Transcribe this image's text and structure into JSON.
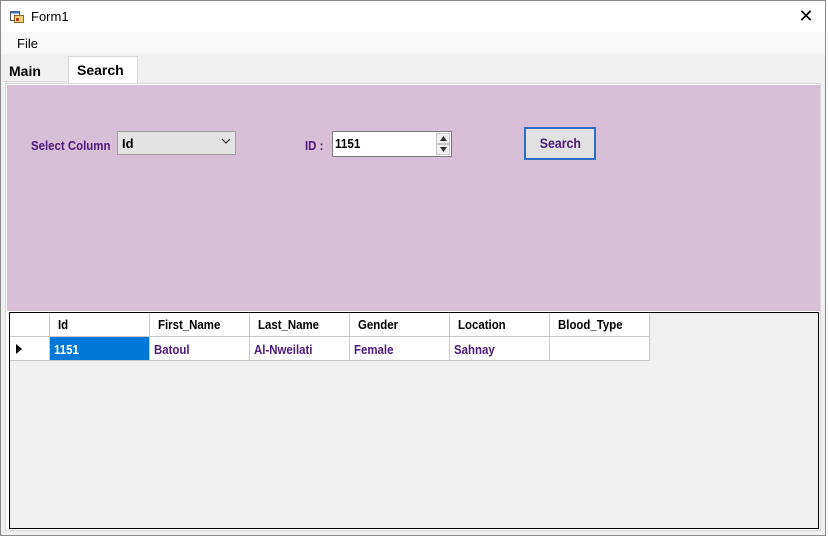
{
  "window": {
    "title": "Form1",
    "close_glyph": "✕",
    "icon": "winforms-app-icon"
  },
  "menu": {
    "file": "File"
  },
  "tabs": [
    {
      "label": "Main"
    },
    {
      "label": "Search"
    }
  ],
  "search": {
    "column_label": "Select Column",
    "column_value": "Id",
    "id_label": "ID :",
    "id_value": "1151",
    "button_label": "Search"
  },
  "grid": {
    "columns": [
      "Id",
      "First_Name",
      "Last_Name",
      "Gender",
      "Location",
      "Blood_Type"
    ],
    "rows": [
      [
        "1151",
        "Batoul",
        "Al-Nweilati",
        "Female",
        "Sahnay",
        ""
      ]
    ]
  },
  "colors": {
    "panel_bg": "#d8bfd8",
    "label_text": "#4b1a7a",
    "selection": "#0078d7",
    "button_border": "#2f6fc2"
  }
}
